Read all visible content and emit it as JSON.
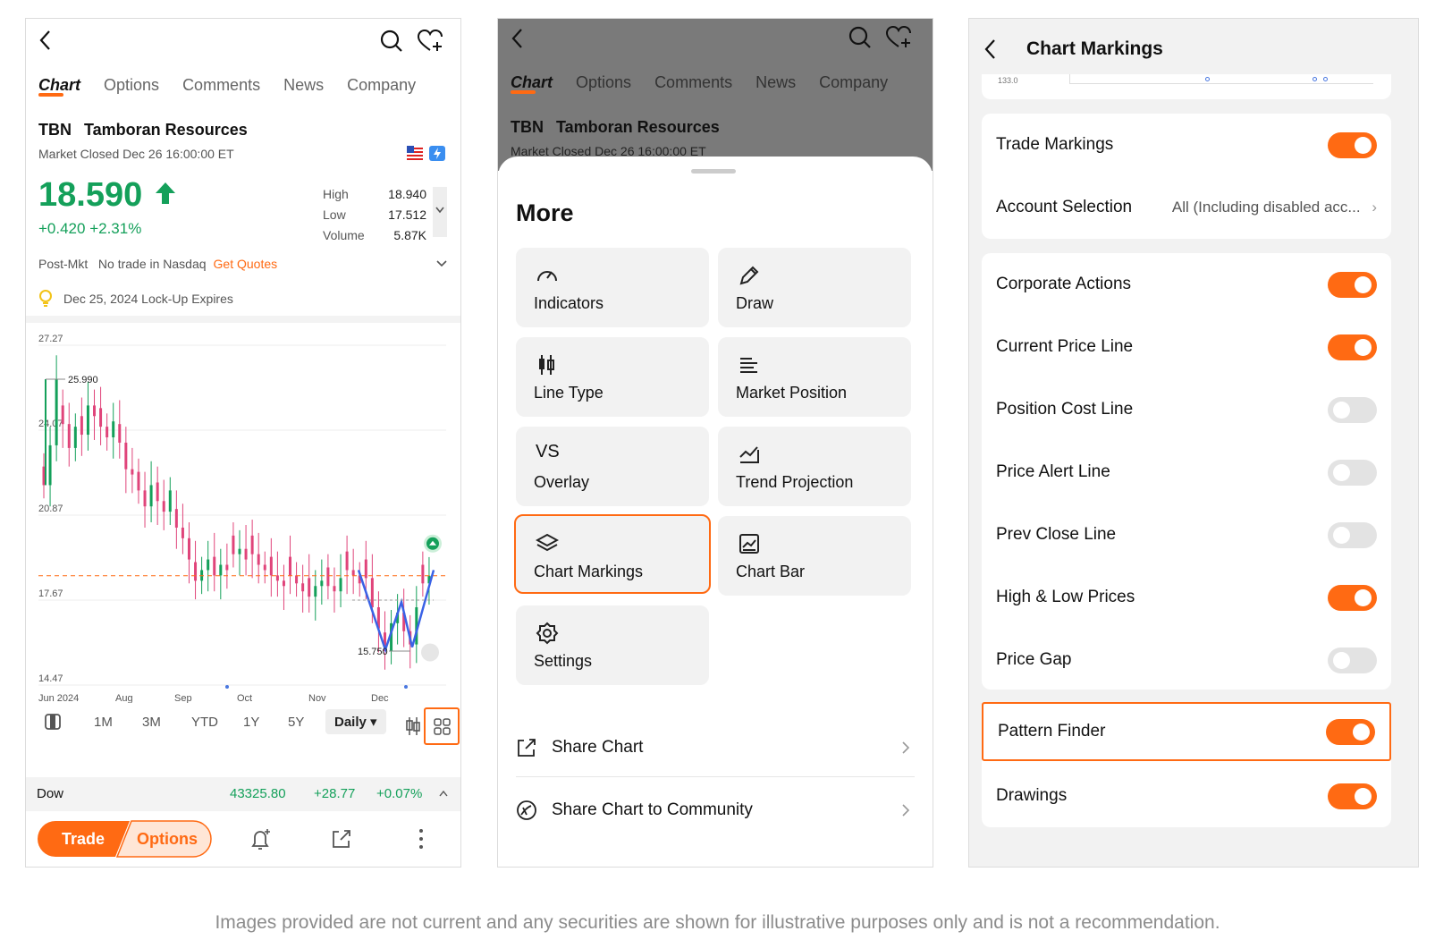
{
  "p1": {
    "tabs": [
      "Chart",
      "Options",
      "Comments",
      "News",
      "Company"
    ],
    "ticker": "TBN",
    "name": "Tamboran Resources",
    "market_status": "Market Closed Dec 26 16:00:00 ET",
    "price": "18.590",
    "change": "+0.420 +2.31%",
    "high_label": "High",
    "high": "18.940",
    "low_label": "Low",
    "low": "17.512",
    "volume_label": "Volume",
    "volume": "5.87K",
    "post_label": "Post-Mkt",
    "post_text": "No trade in Nasdaq",
    "get_quotes": "Get Quotes",
    "event": "Dec 25, 2024 Lock-Up Expires",
    "periods": [
      "1M",
      "3M",
      "YTD",
      "1Y",
      "5Y"
    ],
    "daily": "Daily",
    "dow": {
      "name": "Dow",
      "value": "43325.80",
      "change": "+28.77",
      "pct": "+0.07%"
    },
    "trade": "Trade",
    "options": "Options",
    "chart_data": {
      "type": "candlestick",
      "y_ticks": [
        "27.27",
        "24.07",
        "20.87",
        "17.67",
        "14.47"
      ],
      "x_ticks": [
        "Jun 2024",
        "Aug",
        "Sep",
        "Oct",
        "Nov",
        "Dec"
      ],
      "annotations": [
        "25.990",
        "15.750"
      ],
      "close_path": [
        22.0,
        23.5,
        25.99,
        24.3,
        23.4,
        24.2,
        23.9,
        25.0,
        24.6,
        24.2,
        23.8,
        24.4,
        23.6,
        22.6,
        22.4,
        21.8,
        21.2,
        22.0,
        21.4,
        21.0,
        21.8,
        20.4,
        20.0,
        19.2,
        18.4,
        18.8,
        19.2,
        18.6,
        19.0,
        18.8,
        19.4,
        19.6,
        19.2,
        19.4,
        19.0,
        18.8,
        18.6,
        18.4,
        18.2,
        18.6,
        18.3,
        18.0,
        17.8,
        18.2,
        18.4,
        18.2,
        18.0,
        18.5,
        18.8,
        18.6,
        18.3,
        18.5,
        17.4,
        16.6,
        15.75,
        16.8,
        17.2,
        16.5,
        16.0,
        17.4,
        18.3,
        18.59
      ],
      "current_price_line": 18.59,
      "pattern_line": [
        18.8,
        15.8,
        17.6,
        15.9,
        18.8
      ]
    }
  },
  "p2": {
    "tabs": [
      "Chart",
      "Options",
      "Comments",
      "News",
      "Company"
    ],
    "ticker": "TBN",
    "name": "Tamboran Resources",
    "market_status": "Market Closed Dec 26 16:00:00 ET",
    "title": "More",
    "tiles": [
      "Indicators",
      "Draw",
      "Line Type",
      "Market Position",
      "Overlay",
      "Trend Projection",
      "Chart Markings",
      "Chart Bar",
      "Settings"
    ],
    "overlay_glyph": "VS",
    "share": "Share Chart",
    "share_community": "Share Chart to Community"
  },
  "p3": {
    "title": "Chart Markings",
    "axis_label": "133.0",
    "trade_markings": "Trade Markings",
    "account_selection": "Account Selection",
    "account_value": "All (Including disabled acc...",
    "items": [
      {
        "label": "Corporate Actions",
        "on": true
      },
      {
        "label": "Current Price Line",
        "on": true
      },
      {
        "label": "Position Cost Line",
        "on": false
      },
      {
        "label": "Price Alert Line",
        "on": false
      },
      {
        "label": "Prev Close Line",
        "on": false
      },
      {
        "label": "High & Low Prices",
        "on": true
      },
      {
        "label": "Price Gap",
        "on": false
      }
    ],
    "pattern_finder": "Pattern Finder",
    "drawings": "Drawings"
  },
  "caption": "Images provided are not current and any securities are shown for illustrative purposes only and is not a recommendation.",
  "colors": {
    "accent": "#ff6a13",
    "up": "#14a05a",
    "down": "#e0447a"
  }
}
